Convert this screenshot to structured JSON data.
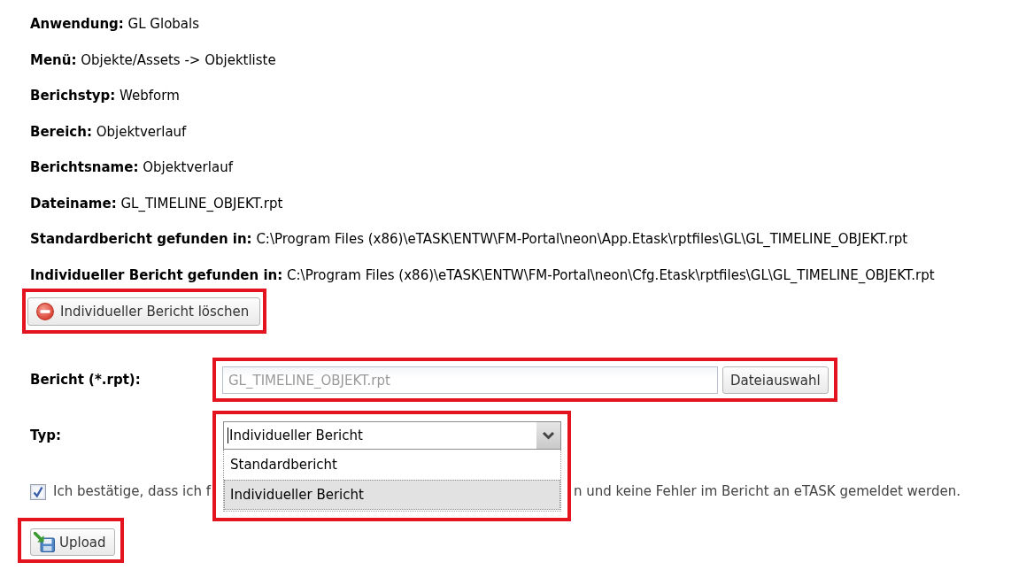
{
  "details": [
    {
      "label": "Anwendung:",
      "value": "GL Globals"
    },
    {
      "label": "Menü:",
      "value": "Objekte/Assets -> Objektliste"
    },
    {
      "label": "Berichstyp:",
      "value": "Webform"
    },
    {
      "label": "Bereich:",
      "value": "Objektverlauf"
    },
    {
      "label": "Berichtsname:",
      "value": "Objektverlauf"
    },
    {
      "label": "Dateiname:",
      "value": "GL_TIMELINE_OBJEKT.rpt"
    },
    {
      "label": "Standardbericht gefunden in:",
      "value": "C:\\Program Files (x86)\\eTASK\\ENTW\\FM-Portal\\neon\\App.Etask\\rptfiles\\GL\\GL_TIMELINE_OBJEKT.rpt"
    },
    {
      "label": "Individueller Bericht gefunden in:",
      "value": "C:\\Program Files (x86)\\eTASK\\ENTW\\FM-Portal\\neon\\Cfg.Etask\\rptfiles\\GL\\GL_TIMELINE_OBJEKT.rpt"
    }
  ],
  "delete_button": {
    "label": "Individueller Bericht löschen",
    "highlighted": true
  },
  "report_field": {
    "label": "Bericht (*.rpt):",
    "placeholder": "GL_TIMELINE_OBJEKT.rpt",
    "button": "Dateiauswahl",
    "highlighted": true
  },
  "type_field": {
    "label": "Typ:",
    "value": "Individueller Bericht",
    "expanded": true,
    "highlighted": true,
    "options": [
      {
        "label": "Standardbericht",
        "selected": false
      },
      {
        "label": "Individueller Bericht",
        "selected": true
      }
    ]
  },
  "confirmation": {
    "checked": true,
    "text_before": "Ich bestätige, dass ich f",
    "text_after": "n und keine Fehler im Bericht an eTASK gemeldet werden."
  },
  "upload_button": {
    "label": "Upload",
    "highlighted": true
  }
}
